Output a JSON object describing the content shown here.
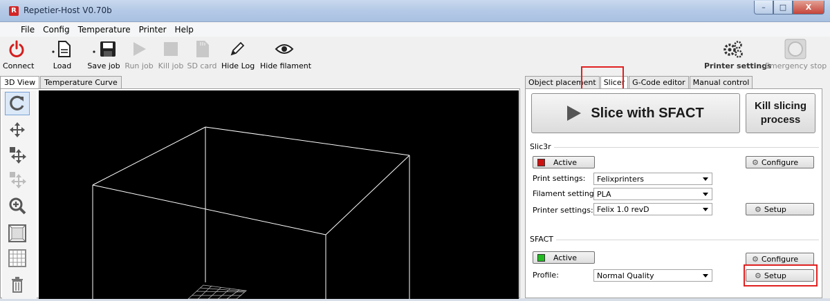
{
  "window": {
    "title": "Repetier-Host V0.70b",
    "app_icon_letter": "R",
    "min_label": "–",
    "max_label": "□",
    "close_label": "X"
  },
  "menu": [
    "File",
    "Config",
    "Temperature",
    "Printer",
    "Help"
  ],
  "toolbar": {
    "connect": "Connect",
    "load": "Load",
    "save_job": "Save job",
    "run_job": "Run job",
    "kill_job": "Kill job",
    "sd_card": "SD card",
    "hide_log": "Hide Log",
    "hide_filament": "Hide filament",
    "printer_settings": "Printer settings",
    "emergency_stop": "Emergency stop"
  },
  "left_tabs": [
    "3D View",
    "Temperature Curve"
  ],
  "right_tabs": [
    "Object placement",
    "Slicer",
    "G-Code editor",
    "Manual control"
  ],
  "slicer": {
    "slice_button": "Slice with SFACT",
    "kill_button_line1": "Kill slicing",
    "kill_button_line2": "process",
    "slic3r": {
      "title": "Slic3r",
      "active_label": "Active",
      "active_color": "#cc1111",
      "configure_label": "Configure",
      "print_settings_label": "Print settings:",
      "print_settings_value": "Felixprinters",
      "filament_settings_label": "Filament settings:",
      "filament_settings_value": "PLA",
      "printer_settings_label": "Printer settings:",
      "printer_settings_value": "Felix 1.0 revD",
      "setup_label": "Setup"
    },
    "sfact": {
      "title": "SFACT",
      "active_label": "Active",
      "active_color": "#22bb22",
      "configure_label": "Configure",
      "profile_label": "Profile:",
      "profile_value": "Normal Quality",
      "setup_label": "Setup"
    }
  },
  "colors": {
    "highlight": "#e02020",
    "viewport_bg": "#000000",
    "wireframe": "#ffffff"
  }
}
